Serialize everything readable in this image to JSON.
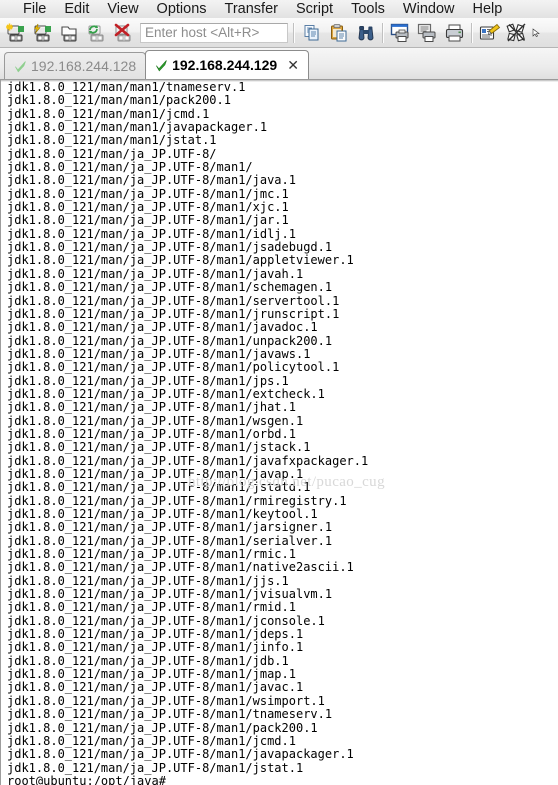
{
  "menubar": {
    "items": [
      {
        "label": "File"
      },
      {
        "label": "Edit"
      },
      {
        "label": "View"
      },
      {
        "label": "Options"
      },
      {
        "label": "Transfer"
      },
      {
        "label": "Script"
      },
      {
        "label": "Tools"
      },
      {
        "label": "Window"
      },
      {
        "label": "Help"
      }
    ]
  },
  "toolbar": {
    "buttons": [
      {
        "name": "new-session-icon",
        "title": "New Session"
      },
      {
        "name": "quick-connect-icon",
        "title": "Quick Connect"
      },
      {
        "name": "new-tab-icon",
        "title": "Connect in Tab"
      },
      {
        "name": "reconnect-icon",
        "title": "Reconnect"
      },
      {
        "name": "disconnect-icon",
        "title": "Disconnect"
      }
    ],
    "host_placeholder": "Enter host <Alt+R>",
    "host_value": "",
    "buttons2": [
      {
        "name": "copy-icon",
        "title": "Copy"
      },
      {
        "name": "paste-icon",
        "title": "Paste"
      },
      {
        "name": "find-icon",
        "title": "Find"
      }
    ],
    "buttons3": [
      {
        "name": "print-screen-icon",
        "title": "Print Screen"
      },
      {
        "name": "print-selection-icon",
        "title": "Print Selection"
      },
      {
        "name": "print-icon",
        "title": "Print"
      }
    ],
    "buttons4": [
      {
        "name": "session-options-icon",
        "title": "Session Options"
      },
      {
        "name": "global-options-icon",
        "title": "Global Options"
      }
    ]
  },
  "tabs": [
    {
      "label": "192.168.244.128",
      "active": false,
      "status_icon": "connected-check-icon",
      "closable": false
    },
    {
      "label": "192.168.244.129",
      "active": true,
      "status_icon": "connected-check-icon",
      "closable": true,
      "close_label": "✕"
    }
  ],
  "terminal": {
    "watermark": "http://blog.csdn.net/pucao_cug",
    "prompt": "root@ubuntu:/opt/java#",
    "lines": [
      "jdk1.8.0_121/man/man1/tnameserv.1",
      "jdk1.8.0_121/man/man1/pack200.1",
      "jdk1.8.0_121/man/man1/jcmd.1",
      "jdk1.8.0_121/man/man1/javapackager.1",
      "jdk1.8.0_121/man/man1/jstat.1",
      "jdk1.8.0_121/man/ja_JP.UTF-8/",
      "jdk1.8.0_121/man/ja_JP.UTF-8/man1/",
      "jdk1.8.0_121/man/ja_JP.UTF-8/man1/java.1",
      "jdk1.8.0_121/man/ja_JP.UTF-8/man1/jmc.1",
      "jdk1.8.0_121/man/ja_JP.UTF-8/man1/xjc.1",
      "jdk1.8.0_121/man/ja_JP.UTF-8/man1/jar.1",
      "jdk1.8.0_121/man/ja_JP.UTF-8/man1/idlj.1",
      "jdk1.8.0_121/man/ja_JP.UTF-8/man1/jsadebugd.1",
      "jdk1.8.0_121/man/ja_JP.UTF-8/man1/appletviewer.1",
      "jdk1.8.0_121/man/ja_JP.UTF-8/man1/javah.1",
      "jdk1.8.0_121/man/ja_JP.UTF-8/man1/schemagen.1",
      "jdk1.8.0_121/man/ja_JP.UTF-8/man1/servertool.1",
      "jdk1.8.0_121/man/ja_JP.UTF-8/man1/jrunscript.1",
      "jdk1.8.0_121/man/ja_JP.UTF-8/man1/javadoc.1",
      "jdk1.8.0_121/man/ja_JP.UTF-8/man1/unpack200.1",
      "jdk1.8.0_121/man/ja_JP.UTF-8/man1/javaws.1",
      "jdk1.8.0_121/man/ja_JP.UTF-8/man1/policytool.1",
      "jdk1.8.0_121/man/ja_JP.UTF-8/man1/jps.1",
      "jdk1.8.0_121/man/ja_JP.UTF-8/man1/extcheck.1",
      "jdk1.8.0_121/man/ja_JP.UTF-8/man1/jhat.1",
      "jdk1.8.0_121/man/ja_JP.UTF-8/man1/wsgen.1",
      "jdk1.8.0_121/man/ja_JP.UTF-8/man1/orbd.1",
      "jdk1.8.0_121/man/ja_JP.UTF-8/man1/jstack.1",
      "jdk1.8.0_121/man/ja_JP.UTF-8/man1/javafxpackager.1",
      "jdk1.8.0_121/man/ja_JP.UTF-8/man1/javap.1",
      "jdk1.8.0_121/man/ja_JP.UTF-8/man1/jstatd.1",
      "jdk1.8.0_121/man/ja_JP.UTF-8/man1/rmiregistry.1",
      "jdk1.8.0_121/man/ja_JP.UTF-8/man1/keytool.1",
      "jdk1.8.0_121/man/ja_JP.UTF-8/man1/jarsigner.1",
      "jdk1.8.0_121/man/ja_JP.UTF-8/man1/serialver.1",
      "jdk1.8.0_121/man/ja_JP.UTF-8/man1/rmic.1",
      "jdk1.8.0_121/man/ja_JP.UTF-8/man1/native2ascii.1",
      "jdk1.8.0_121/man/ja_JP.UTF-8/man1/jjs.1",
      "jdk1.8.0_121/man/ja_JP.UTF-8/man1/jvisualvm.1",
      "jdk1.8.0_121/man/ja_JP.UTF-8/man1/rmid.1",
      "jdk1.8.0_121/man/ja_JP.UTF-8/man1/jconsole.1",
      "jdk1.8.0_121/man/ja_JP.UTF-8/man1/jdeps.1",
      "jdk1.8.0_121/man/ja_JP.UTF-8/man1/jinfo.1",
      "jdk1.8.0_121/man/ja_JP.UTF-8/man1/jdb.1",
      "jdk1.8.0_121/man/ja_JP.UTF-8/man1/jmap.1",
      "jdk1.8.0_121/man/ja_JP.UTF-8/man1/javac.1",
      "jdk1.8.0_121/man/ja_JP.UTF-8/man1/wsimport.1",
      "jdk1.8.0_121/man/ja_JP.UTF-8/man1/tnameserv.1",
      "jdk1.8.0_121/man/ja_JP.UTF-8/man1/pack200.1",
      "jdk1.8.0_121/man/ja_JP.UTF-8/man1/jcmd.1",
      "jdk1.8.0_121/man/ja_JP.UTF-8/man1/javapackager.1",
      "jdk1.8.0_121/man/ja_JP.UTF-8/man1/jstat.1",
      "root@ubuntu:/opt/java#"
    ]
  }
}
